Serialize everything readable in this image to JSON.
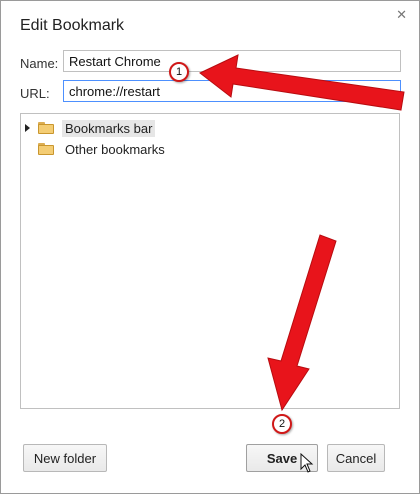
{
  "dialog": {
    "title": "Edit Bookmark"
  },
  "form": {
    "name_label": "Name:",
    "name_value": "Restart Chrome",
    "url_label": "URL:",
    "url_value": "chrome://restart"
  },
  "tree": {
    "items": [
      {
        "label": "Bookmarks bar",
        "expandable": true,
        "selected": true
      },
      {
        "label": "Other bookmarks",
        "expandable": false,
        "selected": false
      }
    ]
  },
  "buttons": {
    "new_folder": "New folder",
    "save": "Save",
    "cancel": "Cancel"
  },
  "annotations": {
    "step1": "1",
    "step2": "2",
    "arrow_color": "#e8141b"
  },
  "icons": {
    "close": "close-icon",
    "folder": "folder-icon",
    "expand": "expand-triangle-icon",
    "cursor": "mouse-pointer-icon"
  }
}
